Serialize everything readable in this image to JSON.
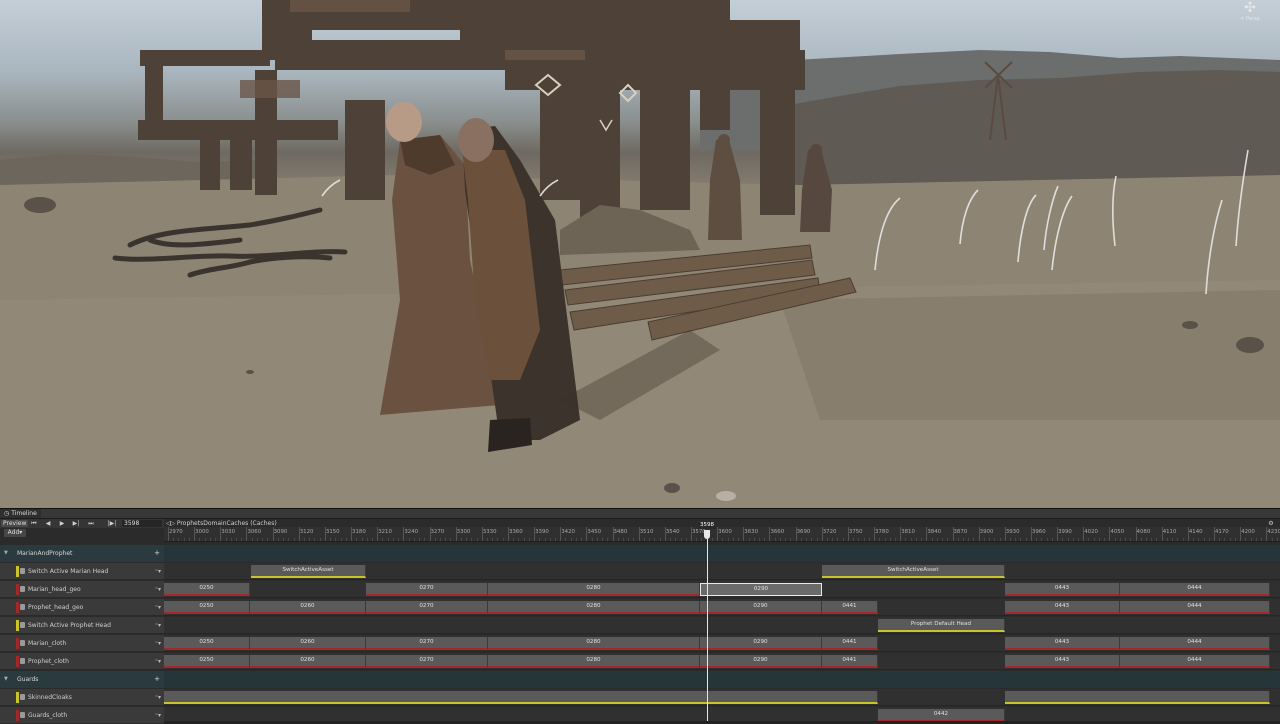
{
  "viewport": {
    "gizmo_label": "< Persp"
  },
  "timeline": {
    "tab_label": "Timeline",
    "preview_label": "Preview",
    "frame_value": "3598",
    "asset_name": "ProphetsDomainCaches (Caches)",
    "add_label": "Add",
    "playhead_label": "3598",
    "ruler_labels": [
      "2970",
      "3000",
      "3030",
      "3060",
      "3090",
      "3120",
      "3150",
      "3180",
      "3210",
      "3240",
      "3270",
      "3300",
      "3330",
      "3360",
      "3390",
      "3420",
      "3450",
      "3480",
      "3510",
      "3540",
      "3570",
      "3600",
      "3630",
      "3660",
      "3690",
      "3720",
      "3750",
      "3780",
      "3810",
      "3840",
      "3870",
      "3900",
      "3930",
      "3960",
      "3990",
      "4020",
      "4050",
      "4080",
      "4110",
      "4140",
      "4170",
      "4200",
      "4230"
    ],
    "rows": [
      {
        "kind": "group",
        "name": "MarianAndProphet",
        "clips": []
      },
      {
        "kind": "track",
        "name": "Switch Active Marian Head",
        "bar": "yellow",
        "clips": [
          {
            "label": "SwitchActiveAsset",
            "accent": "yellow"
          },
          {
            "label": "SwitchActiveAsset",
            "accent": "yellow"
          }
        ]
      },
      {
        "kind": "track",
        "name": "Marian_head_geo",
        "bar": "red",
        "clips": [
          {
            "label": "0250",
            "accent": "red"
          },
          {
            "label": "0270",
            "accent": "red"
          },
          {
            "label": "0280",
            "accent": "red"
          },
          {
            "label": "0290",
            "accent": "red",
            "selected": true
          },
          {
            "label": "0443",
            "accent": "red"
          },
          {
            "label": "0444",
            "accent": "red"
          }
        ]
      },
      {
        "kind": "track",
        "name": "Prophet_head_geo",
        "bar": "red",
        "clips": [
          {
            "label": "0250",
            "accent": "red"
          },
          {
            "label": "0260",
            "accent": "red"
          },
          {
            "label": "0270",
            "accent": "red"
          },
          {
            "label": "0280",
            "accent": "red"
          },
          {
            "label": "0290",
            "accent": "red"
          },
          {
            "label": "0441",
            "accent": "red"
          },
          {
            "label": "0443",
            "accent": "red"
          },
          {
            "label": "0444",
            "accent": "red"
          }
        ]
      },
      {
        "kind": "track",
        "name": "Switch Active Prophet Head",
        "bar": "yellow",
        "clips": [
          {
            "label": "Prophet Default Head",
            "accent": "yellow"
          }
        ]
      },
      {
        "kind": "track",
        "name": "Marian_cloth",
        "bar": "red",
        "clips": [
          {
            "label": "0250",
            "accent": "red"
          },
          {
            "label": "0260",
            "accent": "red"
          },
          {
            "label": "0270",
            "accent": "red"
          },
          {
            "label": "0280",
            "accent": "red"
          },
          {
            "label": "0290",
            "accent": "red"
          },
          {
            "label": "0441",
            "accent": "red"
          },
          {
            "label": "0443",
            "accent": "red"
          },
          {
            "label": "0444",
            "accent": "red"
          }
        ]
      },
      {
        "kind": "track",
        "name": "Prophet_cloth",
        "bar": "red",
        "clips": [
          {
            "label": "0250",
            "accent": "red"
          },
          {
            "label": "0260",
            "accent": "red"
          },
          {
            "label": "0270",
            "accent": "red"
          },
          {
            "label": "0280",
            "accent": "red"
          },
          {
            "label": "0290",
            "accent": "red"
          },
          {
            "label": "0441",
            "accent": "red"
          },
          {
            "label": "0443",
            "accent": "red"
          },
          {
            "label": "0444",
            "accent": "red"
          }
        ]
      },
      {
        "kind": "group",
        "name": "Guards",
        "clips": []
      },
      {
        "kind": "track",
        "name": "SkinnedCloaks",
        "bar": "yellow",
        "clips": [
          {
            "label": "",
            "accent": "yellow"
          },
          {
            "label": "",
            "accent": "yellow"
          }
        ]
      },
      {
        "kind": "track",
        "name": "Guards_cloth",
        "bar": "red",
        "clips": [
          {
            "label": "0442",
            "accent": "red"
          }
        ]
      }
    ]
  },
  "colors": {
    "red_accent": "#a3282a",
    "yellow_accent": "#c8c42a",
    "group_bg": "#26353a",
    "clip_bg": "#5a5a5a"
  }
}
